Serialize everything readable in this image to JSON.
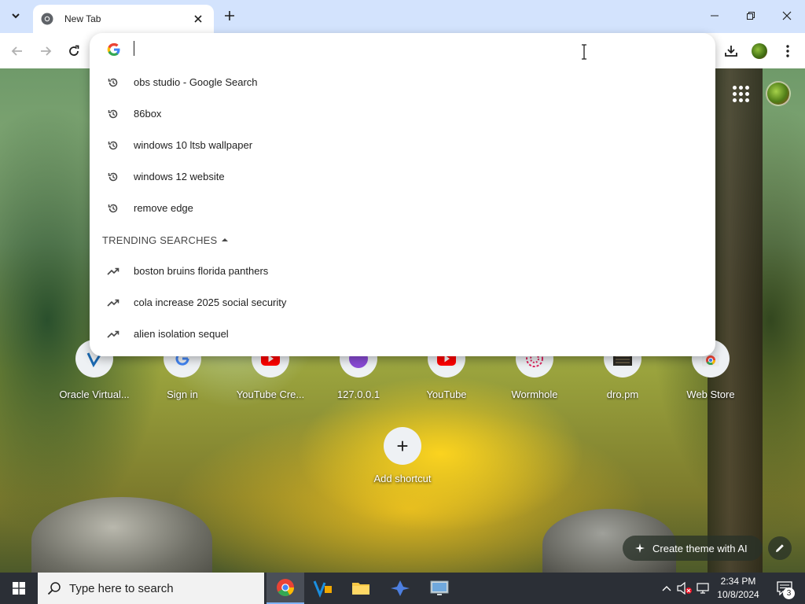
{
  "browser": {
    "tab": {
      "title": "New Tab"
    },
    "omnibox": {
      "value": "",
      "suggestions": [
        {
          "icon": "history-icon",
          "text": "obs studio - Google Search"
        },
        {
          "icon": "history-icon",
          "text": "86box"
        },
        {
          "icon": "history-icon",
          "text": "windows 10 ltsb wallpaper"
        },
        {
          "icon": "history-icon",
          "text": "windows 12 website"
        },
        {
          "icon": "history-icon",
          "text": "remove edge"
        }
      ],
      "trending_header": "TRENDING SEARCHES",
      "trending": [
        {
          "icon": "trending-icon",
          "text": "boston bruins florida panthers"
        },
        {
          "icon": "trending-icon",
          "text": "cola increase 2025 social security"
        },
        {
          "icon": "trending-icon",
          "text": "alien isolation sequel"
        }
      ]
    }
  },
  "ntp": {
    "shortcuts": [
      {
        "label": "Oracle Virtual...",
        "icon": "virtualbox-icon"
      },
      {
        "label": "Sign in",
        "icon": "google-icon"
      },
      {
        "label": "YouTube Cre...",
        "icon": "youtube-icon"
      },
      {
        "label": "127.0.0.1",
        "icon": "ip-icon",
        "glyph": "IP"
      },
      {
        "label": "YouTube",
        "icon": "youtube-icon"
      },
      {
        "label": "Wormhole",
        "icon": "wormhole-icon"
      },
      {
        "label": "dro.pm",
        "icon": "dropm-icon"
      },
      {
        "label": "Web Store",
        "icon": "chrome-webstore-icon"
      }
    ],
    "add_shortcut_label": "Add shortcut",
    "create_theme_label": "Create theme with AI"
  },
  "taskbar": {
    "search_placeholder": "Type here to search",
    "time": "2:34 PM",
    "date": "10/8/2024",
    "notification_count": "3"
  },
  "colors": {
    "accent": "#1a73e8",
    "tabstrip": "#d3e3fd",
    "taskbar": "#2b2f36"
  }
}
